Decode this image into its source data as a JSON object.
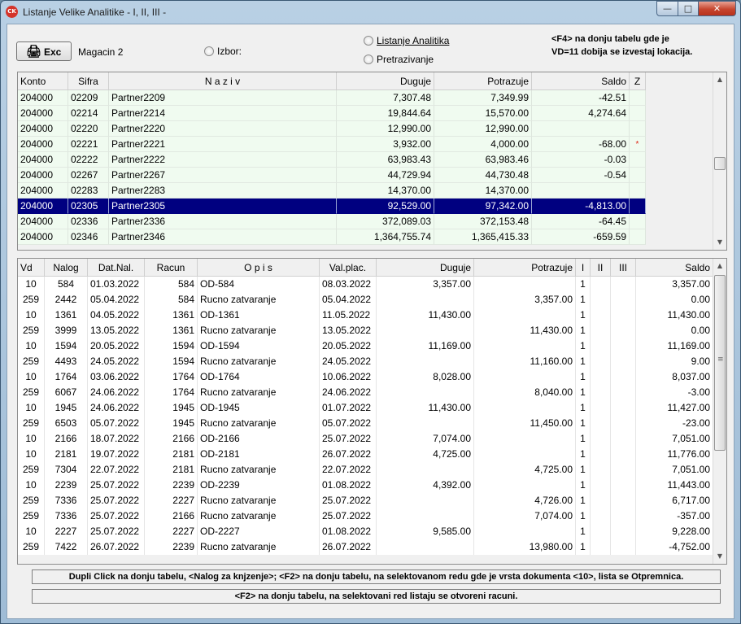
{
  "window": {
    "title": "Listanje Velike Analitike - I, II, III -",
    "icon_text": "CK",
    "controls": {
      "minimize": "—",
      "maximize": "□",
      "close": "✕"
    }
  },
  "toolbar": {
    "exc_button": "Exc",
    "exc_icon": "🖨",
    "magacin": "Magacin 2",
    "izbor_label": "Izbor:",
    "listanje_label": "Listanje Analitika",
    "pretrazivanje_label": "Pretrazivanje",
    "info_line1": "<F4> na donju tabelu gde je",
    "info_line2": "VD=11 dobija se izvestaj lokacija."
  },
  "top_table": {
    "columns": [
      "Konto",
      "Sifra",
      "N a z i v",
      "Duguje",
      "Potrazuje",
      "Saldo",
      "Z"
    ],
    "selected_index": 7,
    "rows": [
      [
        "204000",
        "02209",
        "Partner2209",
        "7,307.48",
        "7,349.99",
        "-42.51",
        ""
      ],
      [
        "204000",
        "02214",
        "Partner2214",
        "19,844.64",
        "15,570.00",
        "4,274.64",
        ""
      ],
      [
        "204000",
        "02220",
        "Partner2220",
        "12,990.00",
        "12,990.00",
        "",
        ""
      ],
      [
        "204000",
        "02221",
        "Partner2221",
        "3,932.00",
        "4,000.00",
        "-68.00",
        "*"
      ],
      [
        "204000",
        "02222",
        "Partner2222",
        "63,983.43",
        "63,983.46",
        "-0.03",
        ""
      ],
      [
        "204000",
        "02267",
        "Partner2267",
        "44,729.94",
        "44,730.48",
        "-0.54",
        ""
      ],
      [
        "204000",
        "02283",
        "Partner2283",
        "14,370.00",
        "14,370.00",
        "",
        ""
      ],
      [
        "204000",
        "02305",
        "Partner2305",
        "92,529.00",
        "97,342.00",
        "-4,813.00",
        ""
      ],
      [
        "204000",
        "02336",
        "Partner2336",
        "372,089.03",
        "372,153.48",
        "-64.45",
        ""
      ],
      [
        "204000",
        "02346",
        "Partner2346",
        "1,364,755.74",
        "1,365,415.33",
        "-659.59",
        ""
      ]
    ]
  },
  "bottom_table": {
    "columns": [
      "Vd",
      "Nalog",
      "Dat.Nal.",
      "Racun",
      "O p i s",
      "Val.plac.",
      "Duguje",
      "Potrazuje",
      "I",
      "II",
      "III",
      "Saldo"
    ],
    "rows": [
      [
        "10",
        "584",
        "01.03.2022",
        "584",
        "OD-584",
        "08.03.2022",
        "3,357.00",
        "",
        "1",
        "",
        "",
        "3,357.00"
      ],
      [
        "259",
        "2442",
        "05.04.2022",
        "584",
        "Rucno zatvaranje",
        "05.04.2022",
        "",
        "3,357.00",
        "1",
        "",
        "",
        "0.00"
      ],
      [
        "10",
        "1361",
        "04.05.2022",
        "1361",
        "OD-1361",
        "11.05.2022",
        "11,430.00",
        "",
        "1",
        "",
        "",
        "11,430.00"
      ],
      [
        "259",
        "3999",
        "13.05.2022",
        "1361",
        "Rucno zatvaranje",
        "13.05.2022",
        "",
        "11,430.00",
        "1",
        "",
        "",
        "0.00"
      ],
      [
        "10",
        "1594",
        "20.05.2022",
        "1594",
        "OD-1594",
        "20.05.2022",
        "11,169.00",
        "",
        "1",
        "",
        "",
        "11,169.00"
      ],
      [
        "259",
        "4493",
        "24.05.2022",
        "1594",
        "Rucno zatvaranje",
        "24.05.2022",
        "",
        "11,160.00",
        "1",
        "",
        "",
        "9.00"
      ],
      [
        "10",
        "1764",
        "03.06.2022",
        "1764",
        "OD-1764",
        "10.06.2022",
        "8,028.00",
        "",
        "1",
        "",
        "",
        "8,037.00"
      ],
      [
        "259",
        "6067",
        "24.06.2022",
        "1764",
        "Rucno zatvaranje",
        "24.06.2022",
        "",
        "8,040.00",
        "1",
        "",
        "",
        "-3.00"
      ],
      [
        "10",
        "1945",
        "24.06.2022",
        "1945",
        "OD-1945",
        "01.07.2022",
        "11,430.00",
        "",
        "1",
        "",
        "",
        "11,427.00"
      ],
      [
        "259",
        "6503",
        "05.07.2022",
        "1945",
        "Rucno zatvaranje",
        "05.07.2022",
        "",
        "11,450.00",
        "1",
        "",
        "",
        "-23.00"
      ],
      [
        "10",
        "2166",
        "18.07.2022",
        "2166",
        "OD-2166",
        "25.07.2022",
        "7,074.00",
        "",
        "1",
        "",
        "",
        "7,051.00"
      ],
      [
        "10",
        "2181",
        "19.07.2022",
        "2181",
        "OD-2181",
        "26.07.2022",
        "4,725.00",
        "",
        "1",
        "",
        "",
        "11,776.00"
      ],
      [
        "259",
        "7304",
        "22.07.2022",
        "2181",
        "Rucno zatvaranje",
        "22.07.2022",
        "",
        "4,725.00",
        "1",
        "",
        "",
        "7,051.00"
      ],
      [
        "10",
        "2239",
        "25.07.2022",
        "2239",
        "OD-2239",
        "01.08.2022",
        "4,392.00",
        "",
        "1",
        "",
        "",
        "11,443.00"
      ],
      [
        "259",
        "7336",
        "25.07.2022",
        "2227",
        "Rucno zatvaranje",
        "25.07.2022",
        "",
        "4,726.00",
        "1",
        "",
        "",
        "6,717.00"
      ],
      [
        "259",
        "7336",
        "25.07.2022",
        "2166",
        "Rucno zatvaranje",
        "25.07.2022",
        "",
        "7,074.00",
        "1",
        "",
        "",
        "-357.00"
      ],
      [
        "10",
        "2227",
        "25.07.2022",
        "2227",
        "OD-2227",
        "01.08.2022",
        "9,585.00",
        "",
        "1",
        "",
        "",
        "9,228.00"
      ],
      [
        "259",
        "7422",
        "26.07.2022",
        "2239",
        "Rucno zatvaranje",
        "26.07.2022",
        "",
        "13,980.00",
        "1",
        "",
        "",
        "-4,752.00"
      ]
    ]
  },
  "hints": {
    "line1": "Dupli Click na donju tabelu, <Nalog za knjzenje>; <F2> na donju tabelu, na selektovanom redu  gde je vrsta dokumenta <10>, lista se Otpremnica.",
    "line2": "<F2> na donju tabelu, na selektovani red  listaju  se otvoreni racuni."
  },
  "colors": {
    "selected_row": "#000080",
    "top_grid_row": "#f0fbf0",
    "title_gradient": "#b9d0e4"
  }
}
